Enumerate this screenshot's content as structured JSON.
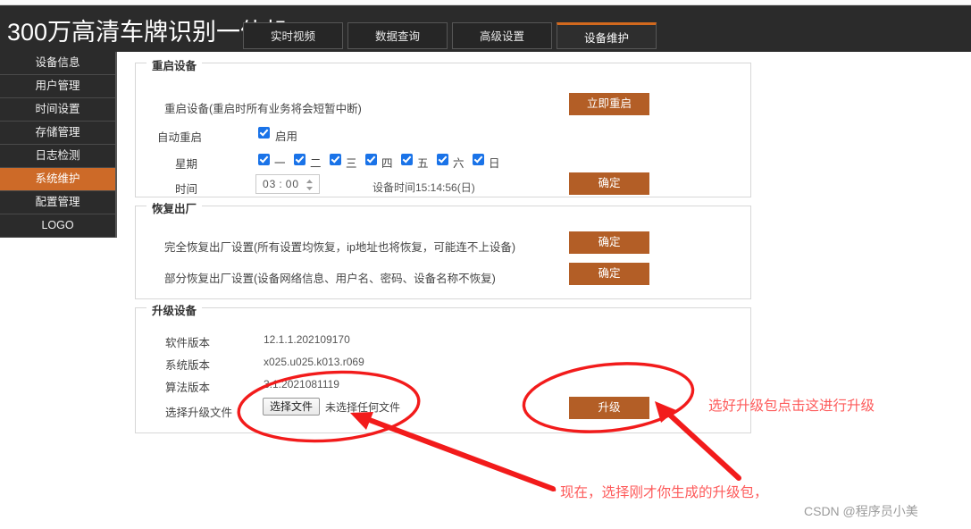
{
  "header": {
    "brand": "300万高清车牌识别一体机",
    "tabs": [
      {
        "label": "实时视频",
        "active": false
      },
      {
        "label": "数据查询",
        "active": false
      },
      {
        "label": "高级设置",
        "active": false
      },
      {
        "label": "设备维护",
        "active": true
      }
    ]
  },
  "sidebar": {
    "items": [
      {
        "label": "设备信息",
        "active": false
      },
      {
        "label": "用户管理",
        "active": false
      },
      {
        "label": "时间设置",
        "active": false
      },
      {
        "label": "存储管理",
        "active": false
      },
      {
        "label": "日志检测",
        "active": false
      },
      {
        "label": "系统维护",
        "active": true
      },
      {
        "label": "配置管理",
        "active": false
      },
      {
        "label": "LOGO",
        "active": false
      }
    ]
  },
  "reboot": {
    "title": "重启设备",
    "reboot_desc": "重启设备(重启时所有业务将会短暂中断)",
    "reboot_button": "立即重启",
    "auto_label": "自动重启",
    "enable_label": "启用",
    "week_label": "星期",
    "days": [
      "一",
      "二",
      "三",
      "四",
      "五",
      "六",
      "日"
    ],
    "time_label": "时间",
    "time_hour": "03",
    "time_sep": ":",
    "time_minute": "00",
    "device_time": "设备时间15:14:56(日)",
    "confirm_button": "确定"
  },
  "factory": {
    "title": "恢复出厂",
    "full_desc": "完全恢复出厂设置(所有设置均恢复，ip地址也将恢复，可能连不上设备)",
    "full_button": "确定",
    "partial_desc": "部分恢复出厂设置(设备网络信息、用户名、密码、设备名称不恢复)",
    "partial_button": "确定"
  },
  "upgrade": {
    "title": "升级设备",
    "rows": [
      {
        "label": "软件版本",
        "value": "12.1.1.202109170"
      },
      {
        "label": "系统版本",
        "value": "x025.u025.k013.r069"
      },
      {
        "label": "算法版本",
        "value": "3.1.2021081119"
      }
    ],
    "file_label": "选择升级文件",
    "file_button": "选择文件",
    "file_status": "未选择任何文件",
    "upgrade_button": "升级"
  },
  "annotations": {
    "upgrade_note": "选好升级包点击这进行升级",
    "select_note": "现在，选择刚才你生成的升级包，"
  },
  "watermark": "CSDN @程序员小美",
  "colors": {
    "accent_orange": "#b35e26",
    "tab_active_orange": "#d2691e",
    "sidebar_active": "#cd6a28",
    "checkbox_blue": "#1a73e8",
    "annotation_red": "#fd5a5a",
    "header_dark": "#2b2b2b"
  }
}
